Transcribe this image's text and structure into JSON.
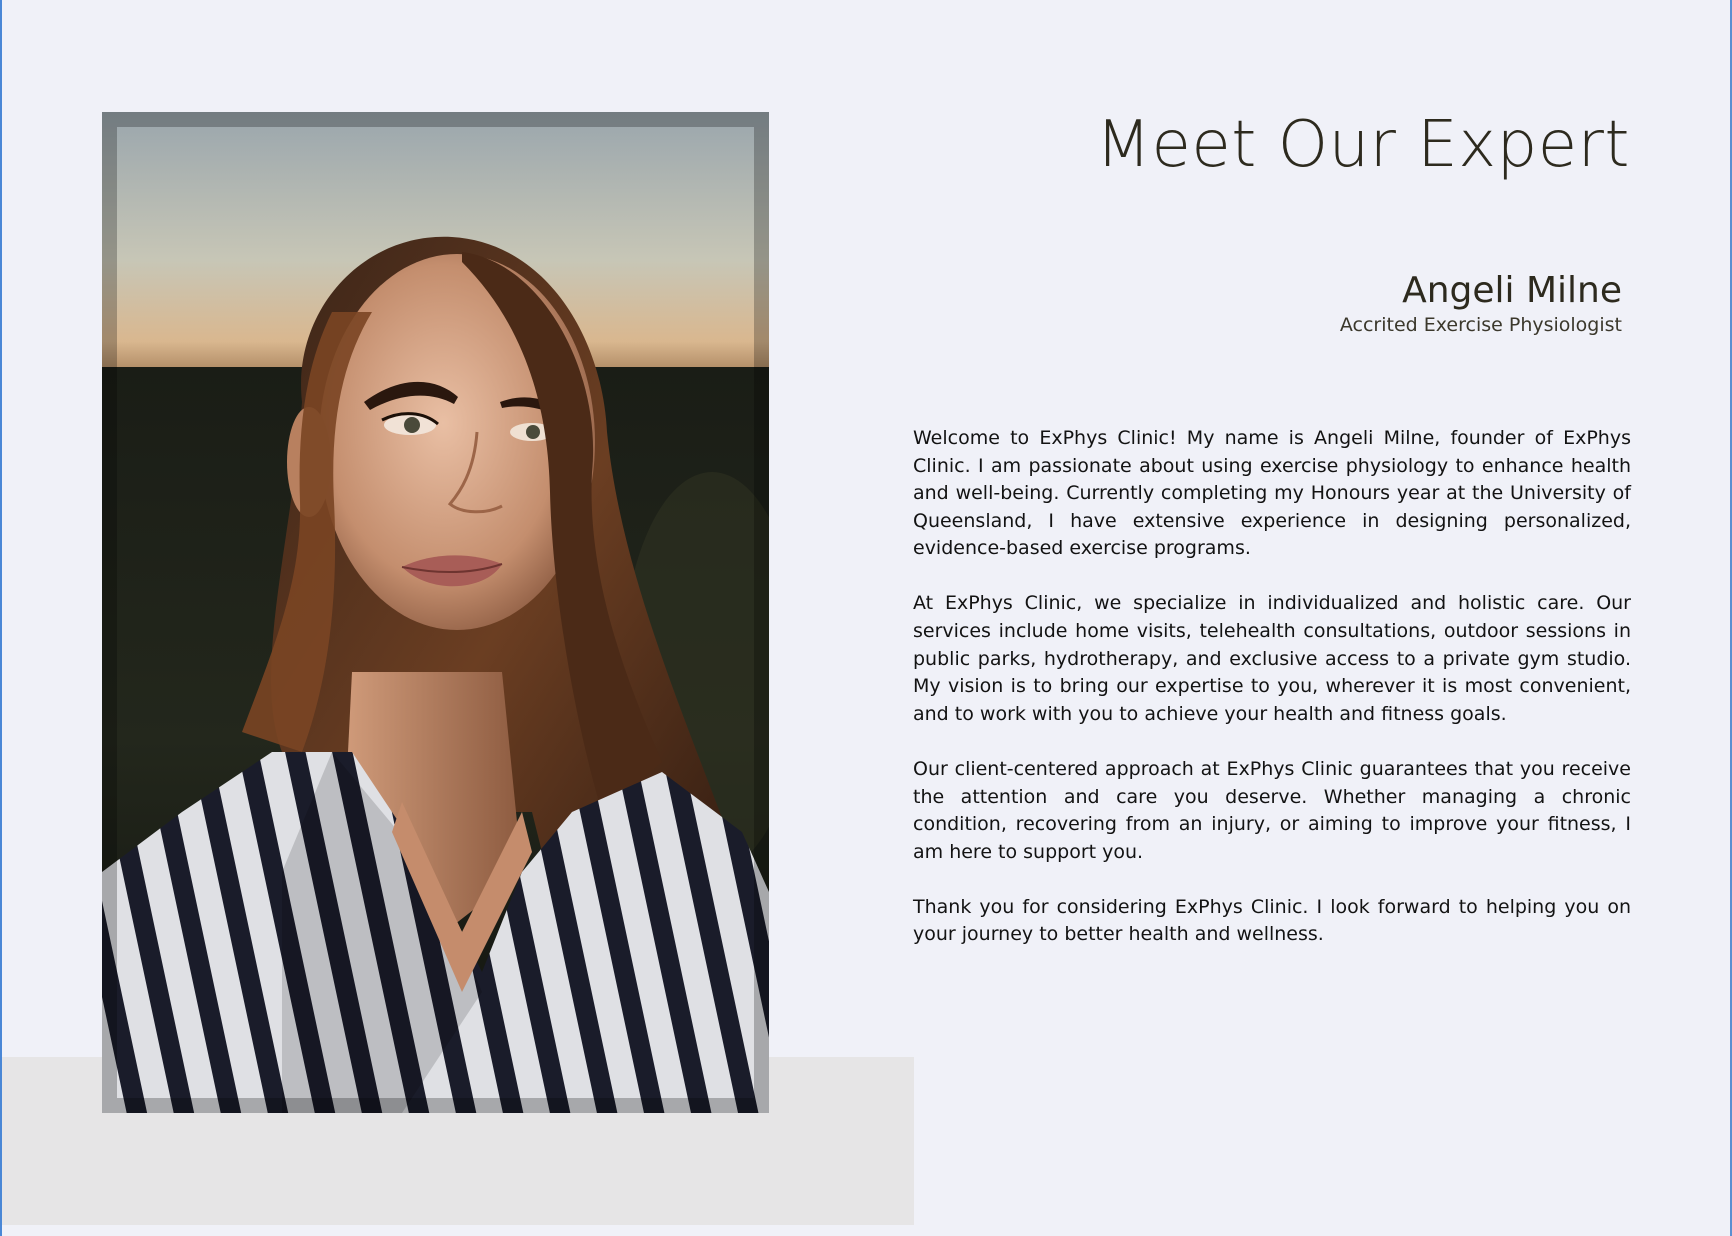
{
  "page": {
    "title": "Meet Our Expert"
  },
  "profile": {
    "name": "Angeli Milne",
    "role": "Accrited Exercise Physiologist",
    "photo_icon": "portrait-photo"
  },
  "bio": {
    "paragraphs": [
      "Welcome to ExPhys Clinic! My name is Angeli Milne, founder of ExPhys Clinic. I am passionate about using exercise physiology to enhance health and well-being. Currently completing my Honours year at the University of Queensland, I have extensive experience in designing personalized, evidence-based exercise programs.",
      "At ExPhys Clinic, we specialize in individualized and holistic care. Our services include home visits, telehealth consultations, outdoor sessions in public parks, hydrotherapy, and exclusive access to a private gym studio. My vision is to bring our expertise to you, wherever it is most convenient, and to work with you to achieve your health and fitness goals.",
      "Our client-centered approach at ExPhys Clinic guarantees that you receive the attention and care you deserve. Whether managing a chronic condition, recovering from an injury, or aiming to improve your fitness, I am here to support you.",
      "Thank you for considering ExPhys Clinic. I look forward to helping you on your journey to better health and wellness."
    ]
  },
  "colors": {
    "background": "#f0f1f8",
    "heading": "#2d2a1e",
    "panel": "#e6e5e6"
  }
}
